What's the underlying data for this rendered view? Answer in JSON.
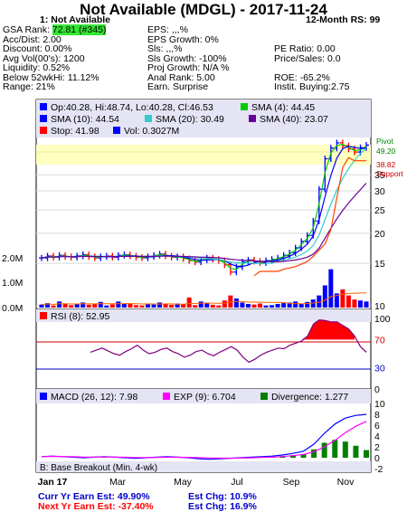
{
  "header": {
    "title": "Not Available (MDGL) - 2017-11-24",
    "subtitle": "1: Not Available",
    "rs": "12-Month RS: 99",
    "col1": [
      "GSA Rank: ",
      "Acc/Dist: 2.00",
      "Discount: 0.00%",
      "Avg Vol(00's): 1200",
      "Liquidity: 0.52%",
      "Below 52wkHi: 11.12%",
      "Range: 21%"
    ],
    "gsa_rank_value": "72.81 (#345)",
    "col2": [
      "EPS: ,,,%",
      "EPS Growth: 0%",
      "Sls: ,,,%",
      "Sls Growth: -100%",
      "Proj Growth: N/A %",
      "Anal Rank: 5.00",
      "Earn. Surprise"
    ],
    "col3": [
      "",
      "",
      "PE Ratio: 0.00",
      "Price/Sales: 0.0",
      "",
      "ROE: -65.2%",
      "Instit. Buying:2.75"
    ]
  },
  "price_legend": {
    "ohlc": "Op:40.28, Hi:48.74, Lo:40.28, Cl:46.53",
    "sma4": "SMA (4): 44.45",
    "sma10": "SMA (10): 44.54",
    "sma20": "SMA (20): 30.49",
    "sma40": "SMA (40): 23.07",
    "stop": "Stop: 41.98",
    "vol": "Vol: 0.3027M"
  },
  "pivot": {
    "label": "Pivot",
    "value": "49.20",
    "support_value": "38.82",
    "support_label": "Support"
  },
  "rsi": {
    "label": "RSI (8): 52.95"
  },
  "macd": {
    "label": "MACD (26, 12): 7.98",
    "exp": "EXP (9): 6.704",
    "div": "Divergence: 1.277"
  },
  "base_note": "B: Base Breakout (Min. 4-wk)",
  "months": [
    "Jan 17",
    "Mar",
    "May",
    "Jul",
    "Sep",
    "Nov"
  ],
  "footer": {
    "curr": "Curr Yr Earn Est: 49.90%",
    "curr_chg": "Est Chg: 10.9%",
    "next": "Next Yr Earn Est: -37.40%",
    "next_chg": "Est Chg: 16.9%"
  },
  "colors": {
    "panel_bg": "#e4e4f4",
    "pivot_band": "#ffffc0",
    "bar": "#0000ff",
    "sma4": "#00cc00",
    "sma10": "#0000ff",
    "sma20": "#33cccc",
    "sma40": "#660099",
    "stop": "#ff0000",
    "macd": "#0000ff",
    "exp": "#ff00ff",
    "divergence": "#008000",
    "rsi": "#800080"
  },
  "chart_data": {
    "type": "line",
    "price_axis": {
      "ticks": [
        10,
        15,
        20,
        25,
        30,
        35
      ],
      "scale": "log",
      "range": [
        10,
        50
      ]
    },
    "volume_axis": {
      "ticks": [
        "0.0M",
        "1.0M",
        "2.0M"
      ],
      "range": [
        0,
        2.6
      ]
    },
    "rsi_axis": {
      "ticks": [
        0,
        30,
        70,
        100
      ],
      "range": [
        0,
        100
      ]
    },
    "macd_axis": {
      "ticks": [
        -2,
        0,
        2,
        4,
        6,
        8,
        10
      ],
      "range": [
        -2,
        10
      ]
    },
    "series_close": [
      15.8,
      16.1,
      15.9,
      16.2,
      16.0,
      15.9,
      16.1,
      16.3,
      16.0,
      15.8,
      16.0,
      16.1,
      15.9,
      16.2,
      16.3,
      16.1,
      15.9,
      15.8,
      16.0,
      16.2,
      16.4,
      16.1,
      15.9,
      16.0,
      15.7,
      15.4,
      15.2,
      15.5,
      15.8,
      15.6,
      15.4,
      14.8,
      13.8,
      14.5,
      15.2,
      15.5,
      15.3,
      15.1,
      15.4,
      15.6,
      15.8,
      16.2,
      16.6,
      17.4,
      18.5,
      19.6,
      22.5,
      30.5,
      40.8,
      45.2,
      47.5,
      46.2,
      44.8,
      43.5,
      45.4,
      46.5
    ],
    "series_volume": [
      0.15,
      0.22,
      0.1,
      0.3,
      0.18,
      0.12,
      0.2,
      0.25,
      0.14,
      0.2,
      0.28,
      0.1,
      0.16,
      0.3,
      0.2,
      0.18,
      0.12,
      0.1,
      0.2,
      0.15,
      0.25,
      0.18,
      0.14,
      0.2,
      0.16,
      0.5,
      0.12,
      0.3,
      0.22,
      0.14,
      0.1,
      0.35,
      0.6,
      0.45,
      0.25,
      0.18,
      0.15,
      0.2,
      0.1,
      0.12,
      0.18,
      0.22,
      0.25,
      0.3,
      0.2,
      0.28,
      0.4,
      0.6,
      1.1,
      1.9,
      0.7,
      0.9,
      0.6,
      0.4,
      0.35,
      0.3
    ],
    "series_rsi": [
      52,
      55,
      58,
      54,
      50,
      48,
      53,
      57,
      62,
      55,
      50,
      52,
      56,
      58,
      53,
      50,
      45,
      48,
      53,
      55,
      50,
      47,
      52,
      56,
      60,
      55,
      45,
      38,
      42,
      48,
      52,
      55,
      58,
      57,
      62,
      65,
      68,
      75,
      92,
      98,
      97,
      95,
      95,
      90,
      85,
      75,
      60,
      52
    ],
    "series_macd": [
      0.2,
      0.3,
      0.2,
      0.1,
      0.0,
      0.1,
      0.2,
      0.1,
      0.0,
      -0.1,
      0.0,
      0.1,
      0.2,
      0.1,
      0.0,
      -0.2,
      -0.3,
      -0.2,
      -0.1,
      0.0,
      0.1,
      0.2,
      0.3,
      0.5,
      0.8,
      1.2,
      2.5,
      4.5,
      6.2,
      7.3,
      7.8,
      7.98
    ],
    "series_exp": [
      0.2,
      0.25,
      0.22,
      0.18,
      0.12,
      0.12,
      0.14,
      0.12,
      0.08,
      0.04,
      0.03,
      0.05,
      0.08,
      0.09,
      0.07,
      0.02,
      -0.05,
      -0.08,
      -0.08,
      -0.05,
      -0.01,
      0.05,
      0.12,
      0.22,
      0.38,
      0.6,
      1.1,
      2.0,
      3.2,
      4.6,
      5.8,
      6.7
    ]
  }
}
